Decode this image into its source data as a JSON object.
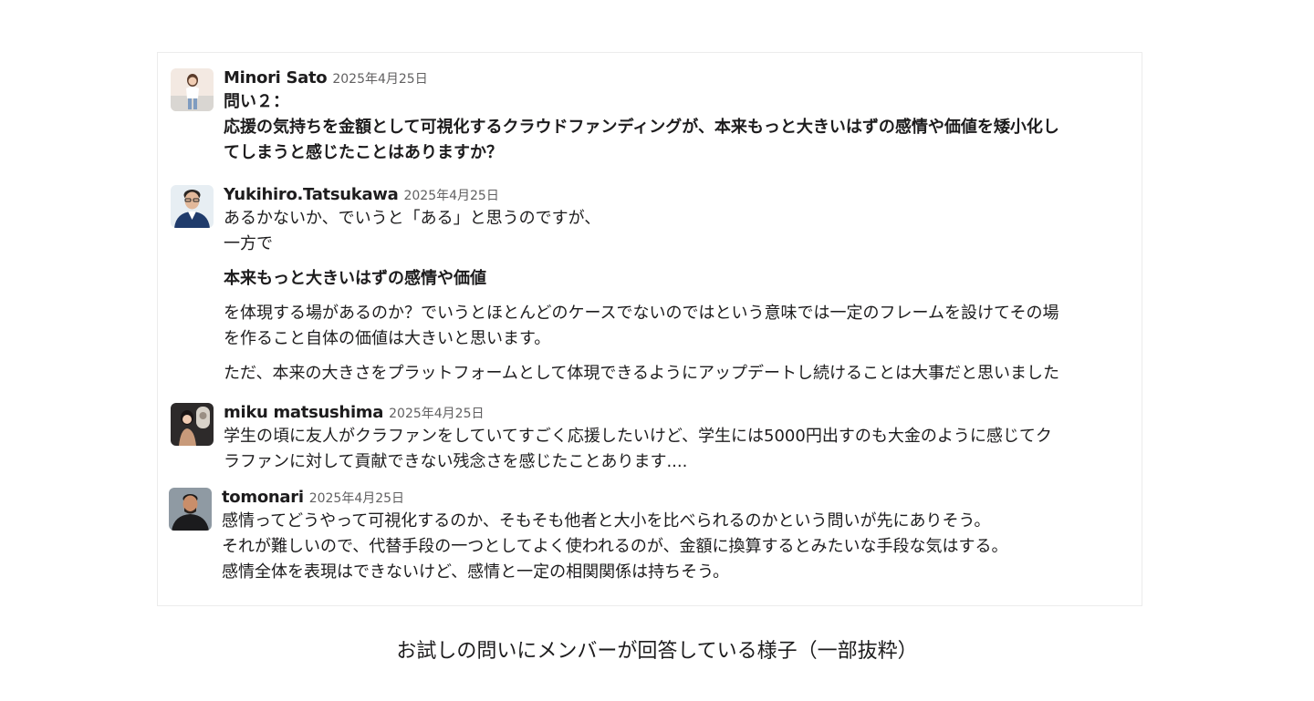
{
  "messages": [
    {
      "author": "Minori Sato",
      "timestamp": "2025年4月25日",
      "avatar": "person-photo-avatar",
      "lines": [
        "問い２：",
        "応援の気持ちを金額として可視化するクラウドファンディングが、本来もっと大きいはずの感情や価値を矮小化し",
        "てしまうと感じたことはありますか？"
      ]
    },
    {
      "author": "Yukihiro.Tatsukawa",
      "timestamp": "2025年4月25日",
      "avatar": "person-photo-avatar",
      "lines": [
        "あるかないか、でいうと「ある」と思うのですが、",
        "一方で",
        "本来もっと大きいはずの感情や価値",
        "を体現する場があるのか？でいうとほとんどのケースでないのではという意味では一定のフレームを設けてその場",
        "を作ること自体の価値は大きいと思います。",
        "ただ、本来の大きさをプラットフォームとして体現できるようにアップデートし続けることは大事だと思いました"
      ]
    },
    {
      "author": "miku matsushima",
      "timestamp": "2025年4月25日",
      "avatar": "person-photo-avatar",
      "lines": [
        "学生の頃に友人がクラファンをしていてすごく応援したいけど、学生には5000円出すのも大金のように感じてク",
        "ラファンに対して貢献できない残念さを感じたことあります...."
      ]
    },
    {
      "author": "tomonari",
      "timestamp": "2025年4月25日",
      "avatar": "person-photo-avatar",
      "lines": [
        "感情ってどうやって可視化するのか、そもそも他者と大小を比べられるのかという問いが先にありそう。",
        "それが難しいので、代替手段の一つとしてよく使われるのが、金額に換算するとみたいな手段な気はする。",
        "感情全体を表現はできないけど、感情と一定の相関関係は持ちそう。"
      ]
    }
  ],
  "caption": "お試しの問いにメンバーが回答している様子（一部抜粋）"
}
